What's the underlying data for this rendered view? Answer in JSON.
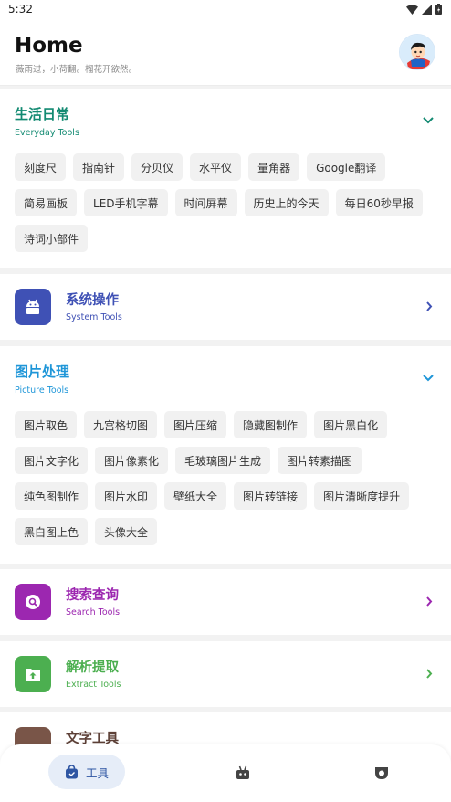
{
  "status_bar": {
    "time": "5:32"
  },
  "header": {
    "title": "Home",
    "subtitle": "薇雨过，小荷翻。榴花开欲然。"
  },
  "sections": {
    "everyday": {
      "title": "生活日常",
      "subtitle": "Everyday Tools",
      "color": "#138a72",
      "chips": [
        "刻度尺",
        "指南针",
        "分贝仪",
        "水平仪",
        "量角器",
        "Google翻译",
        "简易画板",
        "LED手机字幕",
        "时间屏幕",
        "历史上的今天",
        "每日60秒早报",
        "诗词小部件"
      ]
    },
    "system": {
      "title": "系统操作",
      "subtitle": "System Tools",
      "color": "#3f51b5"
    },
    "picture": {
      "title": "图片处理",
      "subtitle": "Picture Tools",
      "color": "#1f96d8",
      "chips": [
        "图片取色",
        "九宫格切图",
        "图片压缩",
        "隐藏图制作",
        "图片黑白化",
        "图片文字化",
        "图片像素化",
        "毛玻璃图片生成",
        "图片转素描图",
        "纯色图制作",
        "图片水印",
        "壁纸大全",
        "图片转链接",
        "图片清晰度提升",
        "黑白图上色",
        "头像大全"
      ]
    },
    "search": {
      "title": "搜索查询",
      "subtitle": "Search Tools",
      "color": "#9c27b0"
    },
    "extract": {
      "title": "解析提取",
      "subtitle": "Extract Tools",
      "color": "#4caf50"
    },
    "text": {
      "title": "文字工具",
      "color": "#795548"
    }
  },
  "bottom_nav": {
    "tools_label": "工具",
    "active_color": "#2f56a3"
  },
  "icons": [
    "wifi-icon",
    "signal-icon",
    "battery-icon",
    "android-icon",
    "search-icon",
    "upload-icon",
    "chevron-down-icon",
    "chevron-right-icon",
    "bag-icon",
    "robot-icon",
    "badge-icon"
  ]
}
